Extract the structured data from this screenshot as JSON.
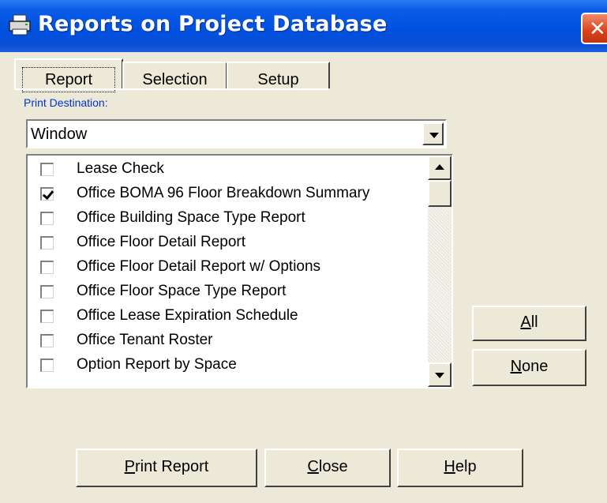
{
  "window": {
    "title": "Reports on Project Database",
    "close_glyph": "✕",
    "title_icon": "printer-icon"
  },
  "tabs": [
    {
      "label": "Report",
      "active": true
    },
    {
      "label": "Selection",
      "active": false
    },
    {
      "label": "Setup",
      "active": false
    }
  ],
  "print_destination": {
    "label": "Print Destination:",
    "value": "Window"
  },
  "reports": [
    {
      "label": "Lease Check",
      "checked": false
    },
    {
      "label": "Office BOMA 96 Floor Breakdown Summary",
      "checked": true
    },
    {
      "label": "Office Building Space Type Report",
      "checked": false
    },
    {
      "label": "Office Floor Detail Report",
      "checked": false
    },
    {
      "label": "Office Floor Detail Report w/ Options",
      "checked": false
    },
    {
      "label": "Office Floor Space Type Report",
      "checked": false
    },
    {
      "label": "Office Lease Expiration Schedule",
      "checked": false
    },
    {
      "label": "Office Tenant Roster",
      "checked": false
    },
    {
      "label": "Option Report by Space",
      "checked": false
    }
  ],
  "side_buttons": {
    "all": {
      "mnemonic": "A",
      "rest": "ll"
    },
    "none": {
      "mnemonic": "N",
      "rest": "one"
    }
  },
  "footer_buttons": {
    "print": {
      "mnemonic": "P",
      "rest": "rint Report"
    },
    "close": {
      "mnemonic": "C",
      "rest": "lose"
    },
    "help": {
      "mnemonic": "H",
      "rest": "elp"
    }
  },
  "colors": {
    "titlebar": "#0050e0",
    "dialog_bg": "#ece9d8",
    "label_blue": "#0033cc",
    "close_red": "#d8421c"
  }
}
